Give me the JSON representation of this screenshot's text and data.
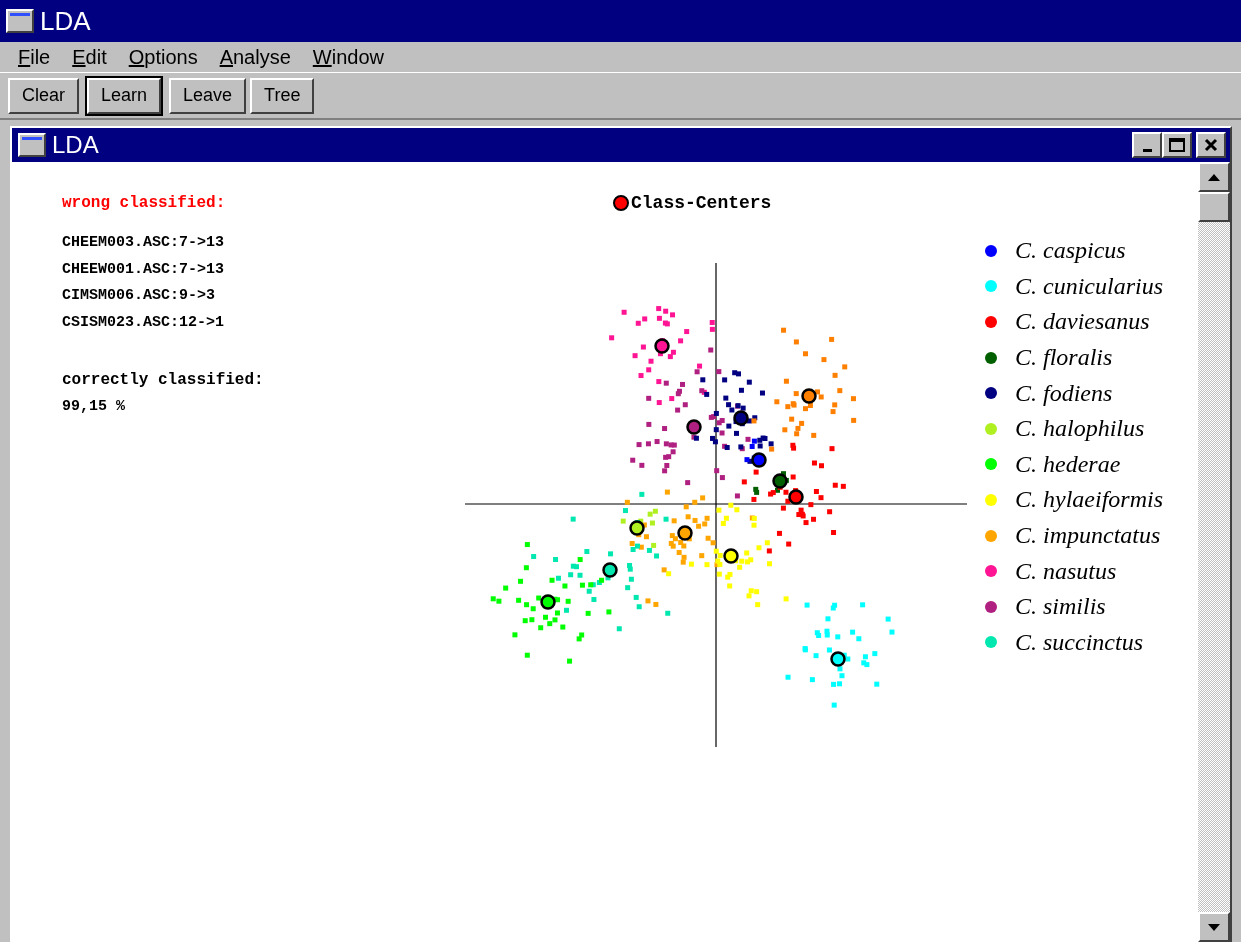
{
  "window": {
    "title": "LDA"
  },
  "menu": [
    {
      "label": "File"
    },
    {
      "label": "Edit"
    },
    {
      "label": "Options"
    },
    {
      "label": "Analyse"
    },
    {
      "label": "Window"
    }
  ],
  "toolbar": [
    {
      "label": "Clear",
      "selected": false
    },
    {
      "label": "Learn",
      "selected": true
    },
    {
      "label": "Leave",
      "selected": false
    },
    {
      "label": "Tree",
      "selected": false
    }
  ],
  "child_window": {
    "title": "LDA",
    "wrong_heading": "wrong classified:",
    "misclassified": [
      "CHEEM003.ASC:7->13",
      "CHEEW001.ASC:7->13",
      "CIMSM006.ASC:9->3",
      "CSISM023.ASC:12->1"
    ],
    "correct_heading": "correctly classified:",
    "correct_value": "99,15 %",
    "plot": {
      "centers_label": "Class-Centers",
      "legend": [
        {
          "label": "C. caspicus",
          "color": "#0000ff"
        },
        {
          "label": "C. cunicularius",
          "color": "#00ffff"
        },
        {
          "label": "C. daviesanus",
          "color": "#ff0000"
        },
        {
          "label": "C. floralis",
          "color": "#006000"
        },
        {
          "label": "C. fodiens",
          "color": "#000080"
        },
        {
          "label": "C. halophilus",
          "color": "#b0f020"
        },
        {
          "label": "C. hederae",
          "color": "#00ff00"
        },
        {
          "label": "C. hylaeiformis",
          "color": "#ffff00"
        },
        {
          "label": "C. impunctatus",
          "color": "#ffa500"
        },
        {
          "label": "C. nasutus",
          "color": "#ff1493"
        },
        {
          "label": "C. similis",
          "color": "#b02080"
        },
        {
          "label": "C. succinctus",
          "color": "#00e8b0"
        }
      ]
    }
  }
}
